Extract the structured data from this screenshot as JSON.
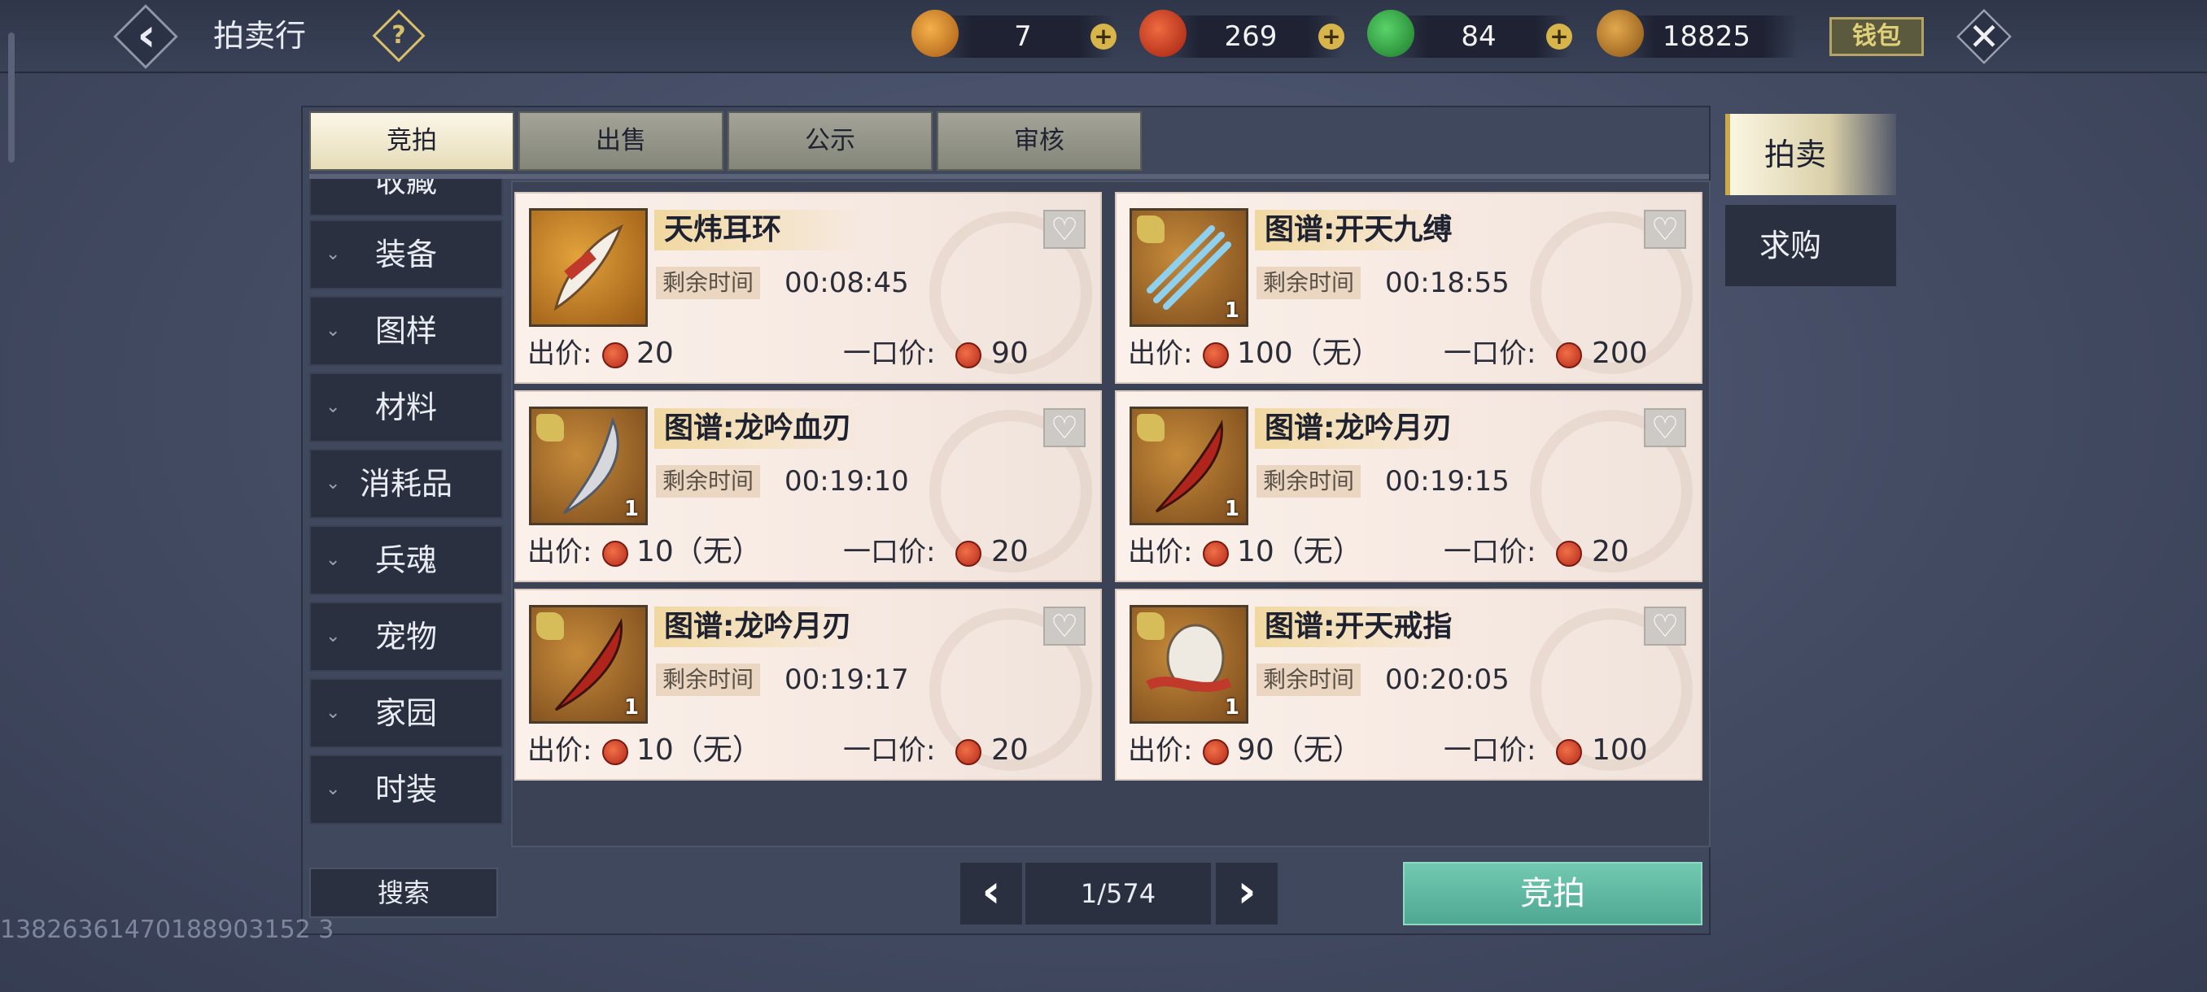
{
  "header": {
    "title": "拍卖行",
    "currencies": [
      {
        "icon": "gold-ingot-icon",
        "value": "7"
      },
      {
        "icon": "red-coin-icon",
        "value": "269"
      },
      {
        "icon": "jade-coin-icon",
        "value": "84"
      },
      {
        "icon": "copper-coin-icon",
        "value": "18825"
      }
    ],
    "wallet_label": "钱包"
  },
  "tabs": [
    "竞拍",
    "出售",
    "公示",
    "审核"
  ],
  "active_tab": "竞拍",
  "categories": [
    "收藏",
    "装备",
    "图样",
    "材料",
    "消耗品",
    "兵魂",
    "宠物",
    "家园",
    "时装"
  ],
  "side_tabs": [
    "拍卖",
    "求购"
  ],
  "active_side_tab": "拍卖",
  "labels": {
    "remain": "剩余时间",
    "bid": "出价:",
    "buyout": "一口价:"
  },
  "items": [
    {
      "name": "天炜耳环",
      "remain": "00:08:45",
      "bid": "20",
      "buyout": "90",
      "qty": "",
      "blueprint": false
    },
    {
      "name": "图谱:开天九缚",
      "remain": "00:18:55",
      "bid": "100（无）",
      "buyout": "200",
      "qty": "1",
      "blueprint": true
    },
    {
      "name": "图谱:龙吟血刃",
      "remain": "00:19:10",
      "bid": "10（无）",
      "buyout": "20",
      "qty": "1",
      "blueprint": true
    },
    {
      "name": "图谱:龙吟月刃",
      "remain": "00:19:15",
      "bid": "10（无）",
      "buyout": "20",
      "qty": "1",
      "blueprint": true
    },
    {
      "name": "图谱:龙吟月刃",
      "remain": "00:19:17",
      "bid": "10（无）",
      "buyout": "20",
      "qty": "1",
      "blueprint": true
    },
    {
      "name": "图谱:开天戒指",
      "remain": "00:20:05",
      "bid": "90（无）",
      "buyout": "100",
      "qty": "1",
      "blueprint": true
    }
  ],
  "footer": {
    "search_label": "搜索",
    "page": "1/574",
    "bid_button": "竞拍",
    "watermark": "13826361470188903152 3"
  },
  "colors": {
    "accent_green": "#5db79f",
    "tab_active": "#f4ecd0",
    "gold": "#d7b54b"
  }
}
